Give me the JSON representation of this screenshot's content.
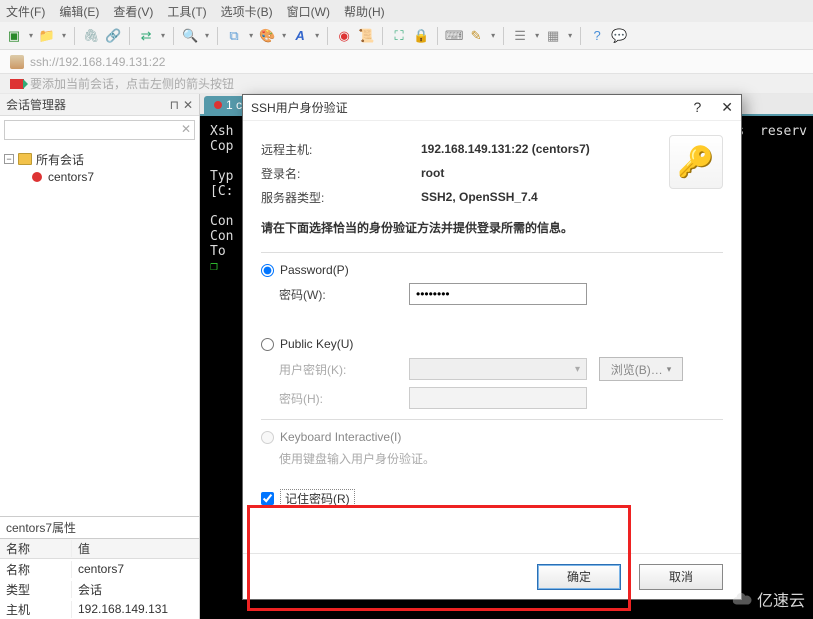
{
  "menu": {
    "file": "文件(F)",
    "edit": "编辑(E)",
    "view": "查看(V)",
    "tools": "工具(T)",
    "tabs": "选项卡(B)",
    "window": "窗口(W)",
    "help": "帮助(H)"
  },
  "address": {
    "url": "ssh://192.168.149.131:22"
  },
  "hint": "要添加当前会话，点击左侧的箭头按钮",
  "session_panel": {
    "title": "会话管理器",
    "root": "所有会话",
    "item": "centors7"
  },
  "tab": {
    "label": "1 c"
  },
  "terminal": {
    "line1": "Xsh",
    "line2": "Cop",
    "line3": "Typ",
    "line4": "[C:",
    "line5": "Con",
    "line6": "Con",
    "line7": "To ",
    "line8": "❐",
    "right_text": "s  reserv"
  },
  "props": {
    "title_suffix": "属性",
    "col_name": "名称",
    "col_value": "值",
    "rows": [
      {
        "k": "名称",
        "v": "centors7"
      },
      {
        "k": "类型",
        "v": "会话"
      },
      {
        "k": "主机",
        "v": "192.168.149.131"
      }
    ]
  },
  "dialog": {
    "title": "SSH用户身份验证",
    "remote_host_label": "远程主机:",
    "remote_host_value": "192.168.149.131:22 (centors7)",
    "login_label": "登录名:",
    "login_value": "root",
    "server_type_label": "服务器类型:",
    "server_type_value": "SSH2, OpenSSH_7.4",
    "instruction": "请在下面选择恰当的身份验证方法并提供登录所需的信息。",
    "password_option": "Password(P)",
    "password_field_label": "密码(W):",
    "password_value": "••••••••",
    "publickey_option": "Public Key(U)",
    "userkey_label": "用户密钥(K):",
    "browse": "浏览(B)…",
    "passphrase_label": "密码(H):",
    "ki_option": "Keyboard Interactive(I)",
    "ki_desc": "使用键盘输入用户身份验证。",
    "remember": "记住密码(R)",
    "ok": "确定",
    "cancel": "取消"
  },
  "watermark": "亿速云"
}
